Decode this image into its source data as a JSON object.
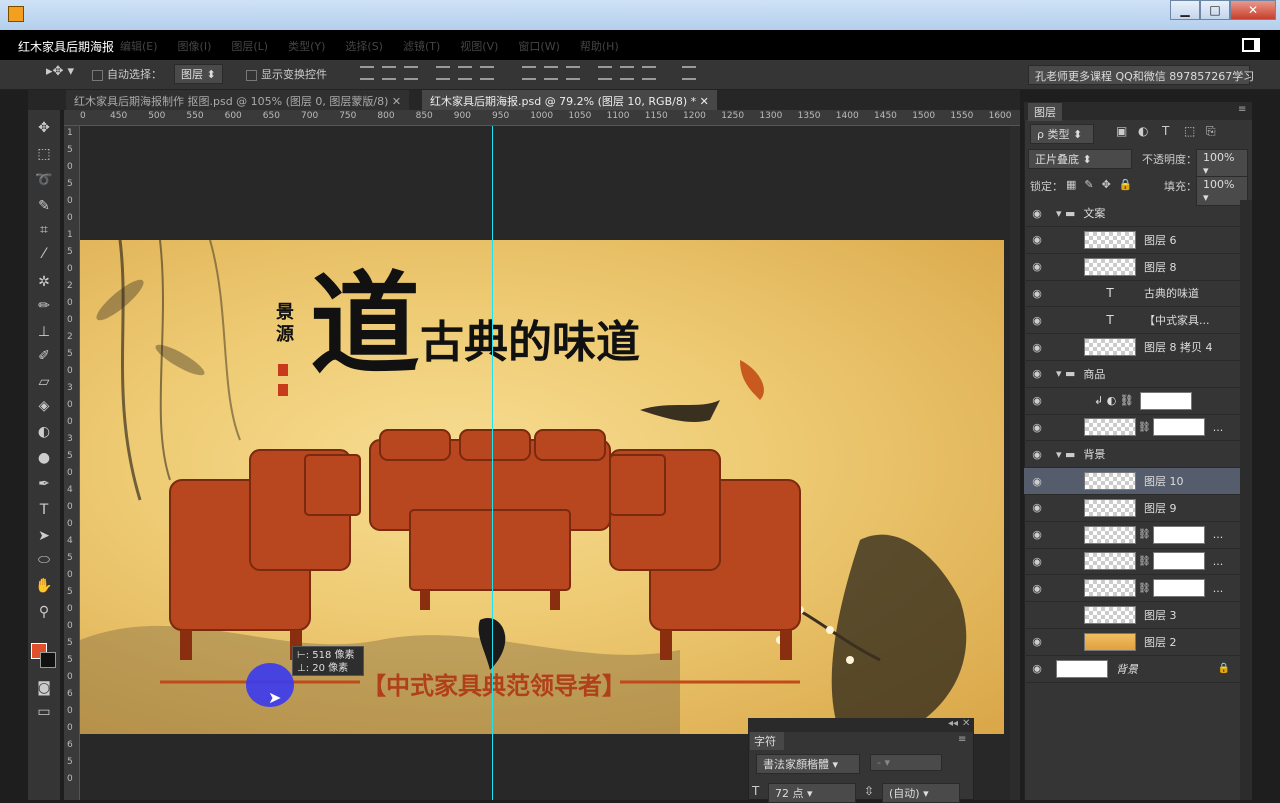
{
  "window": {
    "minimize_label": "▁",
    "maximize_label": "□",
    "close_label": "✕"
  },
  "app": {
    "title": "红木家具后期海报",
    "menu": [
      "编辑(E)",
      "图像(I)",
      "图层(L)",
      "类型(Y)",
      "选择(S)",
      "滤镜(T)",
      "视图(V)",
      "窗口(W)",
      "帮助(H)"
    ]
  },
  "options": {
    "auto_select_label": "自动选择：",
    "auto_select_value": "图层",
    "show_transform_label": "显示变换控件",
    "teacher_text": "孔老师更多课程 QQ和微信 897857267学习"
  },
  "tabs": [
    {
      "label": "红木家具后期海报制作 抠图.psd @ 105% (图层 0, 图层蒙版/8)",
      "close": "✕"
    },
    {
      "label": "红木家具后期海报.psd @ 79.2% (图层 10, RGB/8) *",
      "close": "✕"
    }
  ],
  "ruler": {
    "h_labels": [
      "0",
      "450",
      "500",
      "550",
      "600",
      "650",
      "700",
      "750",
      "800",
      "850",
      "900",
      "950",
      "1000",
      "1050",
      "1100",
      "1150",
      "1200",
      "1250",
      "1300",
      "1350",
      "1400",
      "1450",
      "1500",
      "1550",
      "1600"
    ],
    "v_labels": [
      "1",
      "5",
      "0",
      "5",
      "0",
      "0",
      "1",
      "5",
      "0",
      "2",
      "0",
      "0",
      "2",
      "5",
      "0",
      "3",
      "0",
      "0",
      "3",
      "5",
      "0",
      "4",
      "0",
      "0",
      "4",
      "5",
      "0",
      "5",
      "0",
      "0",
      "5",
      "5",
      "0",
      "6",
      "0",
      "0",
      "6",
      "5",
      "0"
    ]
  },
  "poster": {
    "title_big": "道",
    "title_rest": "古典的味道",
    "side_text": "景源",
    "slogan": "【中式家具典范领导者】"
  },
  "tooltip": {
    "line1": "⊢: 518 像素",
    "line2": "⊥: 20 像素"
  },
  "character_panel": {
    "tab": "字符",
    "font": "書法家顏楷體",
    "style": "-",
    "size": "72 点",
    "leading": "(自动)"
  },
  "layers_panel": {
    "tab": "图层",
    "filter_label": "ρ 类型",
    "blend_mode": "正片叠底",
    "opacity_label": "不透明度：",
    "opacity_value": "100%",
    "lock_label": "锁定：",
    "fill_label": "填充：",
    "fill_value": "100%",
    "layers": [
      {
        "name": "文案",
        "type": "group"
      },
      {
        "name": "图层 6",
        "type": "pixel"
      },
      {
        "name": "图层 8",
        "type": "pixel"
      },
      {
        "name": "古典的味道",
        "type": "text"
      },
      {
        "name": "【中式家具...",
        "type": "text"
      },
      {
        "name": "图层 8 拷贝 4",
        "type": "pixel"
      },
      {
        "name": "商品",
        "type": "group"
      },
      {
        "name": "",
        "type": "adjustment"
      },
      {
        "name": "...",
        "type": "masked"
      },
      {
        "name": "背景",
        "type": "group"
      },
      {
        "name": "图层 10",
        "type": "pixel",
        "selected": true
      },
      {
        "name": "图层 9",
        "type": "pixel"
      },
      {
        "name": "...",
        "type": "masked"
      },
      {
        "name": "...",
        "type": "masked"
      },
      {
        "name": "...",
        "type": "masked"
      },
      {
        "name": "图层 3",
        "type": "pixel"
      },
      {
        "name": "图层 2",
        "type": "pixel"
      },
      {
        "name": "背景",
        "type": "background"
      }
    ]
  },
  "colors": {
    "foreground": "#e0502a",
    "background": "#111111",
    "guide": "#21e0f0",
    "selected_layer": "#555c6b"
  }
}
